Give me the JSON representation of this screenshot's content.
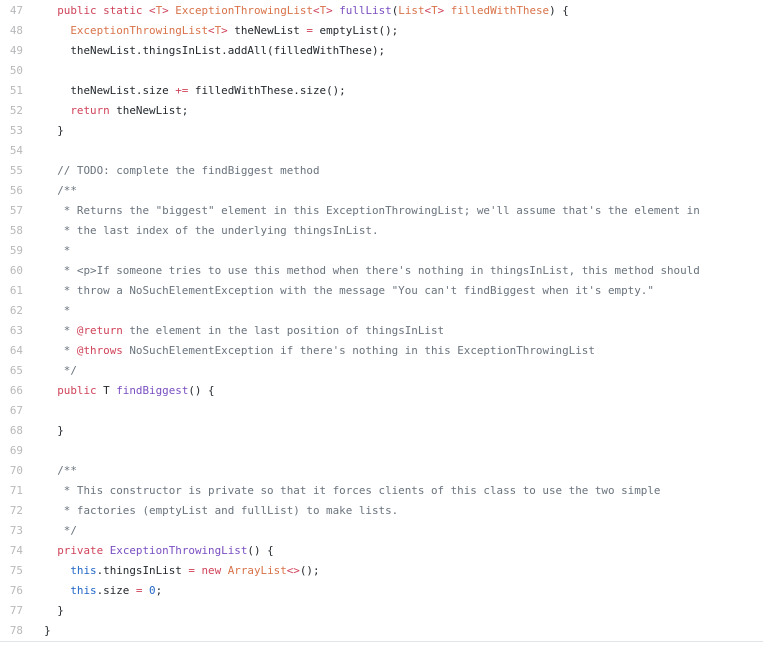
{
  "editor": {
    "language": "java",
    "lines": [
      {
        "num": "47",
        "tokens": [
          {
            "t": "    ",
            "c": "plain"
          },
          {
            "t": "public",
            "c": "kw"
          },
          {
            "t": " ",
            "c": "plain"
          },
          {
            "t": "static",
            "c": "kw"
          },
          {
            "t": " ",
            "c": "plain"
          },
          {
            "t": "<",
            "c": "kw"
          },
          {
            "t": "T",
            "c": "type"
          },
          {
            "t": ">",
            "c": "kw"
          },
          {
            "t": " ",
            "c": "plain"
          },
          {
            "t": "ExceptionThrowingList",
            "c": "type"
          },
          {
            "t": "<",
            "c": "kw"
          },
          {
            "t": "T",
            "c": "type"
          },
          {
            "t": ">",
            "c": "kw"
          },
          {
            "t": " ",
            "c": "plain"
          },
          {
            "t": "fullList",
            "c": "ent"
          },
          {
            "t": "(",
            "c": "plain"
          },
          {
            "t": "List",
            "c": "type"
          },
          {
            "t": "<",
            "c": "kw"
          },
          {
            "t": "T",
            "c": "type"
          },
          {
            "t": ">",
            "c": "kw"
          },
          {
            "t": " ",
            "c": "plain"
          },
          {
            "t": "filledWithThese",
            "c": "type"
          },
          {
            "t": ") {",
            "c": "plain"
          }
        ]
      },
      {
        "num": "48",
        "tokens": [
          {
            "t": "      ",
            "c": "plain"
          },
          {
            "t": "ExceptionThrowingList",
            "c": "type"
          },
          {
            "t": "<",
            "c": "kw"
          },
          {
            "t": "T",
            "c": "type"
          },
          {
            "t": ">",
            "c": "kw"
          },
          {
            "t": " theNewList ",
            "c": "plain"
          },
          {
            "t": "=",
            "c": "kw"
          },
          {
            "t": " emptyList();",
            "c": "plain"
          }
        ]
      },
      {
        "num": "49",
        "tokens": [
          {
            "t": "      theNewList.thingsInList.addAll(filledWithThese);",
            "c": "plain"
          }
        ]
      },
      {
        "num": "50",
        "tokens": []
      },
      {
        "num": "51",
        "tokens": [
          {
            "t": "      theNewList.size ",
            "c": "plain"
          },
          {
            "t": "+=",
            "c": "kw"
          },
          {
            "t": " filledWithThese.size();",
            "c": "plain"
          }
        ]
      },
      {
        "num": "52",
        "tokens": [
          {
            "t": "      ",
            "c": "plain"
          },
          {
            "t": "return",
            "c": "kw"
          },
          {
            "t": " theNewList;",
            "c": "plain"
          }
        ]
      },
      {
        "num": "53",
        "tokens": [
          {
            "t": "    }",
            "c": "plain"
          }
        ]
      },
      {
        "num": "54",
        "tokens": []
      },
      {
        "num": "55",
        "tokens": [
          {
            "t": "    ",
            "c": "plain"
          },
          {
            "t": "// TODO: complete the findBiggest method",
            "c": "cmt"
          }
        ]
      },
      {
        "num": "56",
        "tokens": [
          {
            "t": "    ",
            "c": "plain"
          },
          {
            "t": "/**",
            "c": "cmt"
          }
        ]
      },
      {
        "num": "57",
        "tokens": [
          {
            "t": "     * Returns the \"biggest\" element in this ExceptionThrowingList; we'll assume that's the element in",
            "c": "cmt"
          }
        ]
      },
      {
        "num": "58",
        "tokens": [
          {
            "t": "     * the last index of the underlying thingsInList.",
            "c": "cmt"
          }
        ]
      },
      {
        "num": "59",
        "tokens": [
          {
            "t": "     *",
            "c": "cmt"
          }
        ]
      },
      {
        "num": "60",
        "tokens": [
          {
            "t": "     * <p>If someone tries to use this method when there's nothing in thingsInList, this method should",
            "c": "cmt"
          }
        ]
      },
      {
        "num": "61",
        "tokens": [
          {
            "t": "     * throw a NoSuchElementException with the message \"You can't findBiggest when it's empty.\"",
            "c": "cmt"
          }
        ]
      },
      {
        "num": "62",
        "tokens": [
          {
            "t": "     *",
            "c": "cmt"
          }
        ]
      },
      {
        "num": "63",
        "tokens": [
          {
            "t": "     * ",
            "c": "cmt"
          },
          {
            "t": "@return",
            "c": "tag"
          },
          {
            "t": " the element in the last position of thingsInList",
            "c": "cmt"
          }
        ]
      },
      {
        "num": "64",
        "tokens": [
          {
            "t": "     * ",
            "c": "cmt"
          },
          {
            "t": "@throws",
            "c": "tag"
          },
          {
            "t": " NoSuchElementException if there's nothing in this ExceptionThrowingList",
            "c": "cmt"
          }
        ]
      },
      {
        "num": "65",
        "tokens": [
          {
            "t": "     */",
            "c": "cmt"
          }
        ]
      },
      {
        "num": "66",
        "tokens": [
          {
            "t": "    ",
            "c": "plain"
          },
          {
            "t": "public",
            "c": "kw"
          },
          {
            "t": " T ",
            "c": "plain"
          },
          {
            "t": "findBiggest",
            "c": "ent"
          },
          {
            "t": "() {",
            "c": "plain"
          }
        ]
      },
      {
        "num": "67",
        "tokens": []
      },
      {
        "num": "68",
        "tokens": [
          {
            "t": "    }",
            "c": "plain"
          }
        ]
      },
      {
        "num": "69",
        "tokens": []
      },
      {
        "num": "70",
        "tokens": [
          {
            "t": "    ",
            "c": "plain"
          },
          {
            "t": "/**",
            "c": "cmt"
          }
        ]
      },
      {
        "num": "71",
        "tokens": [
          {
            "t": "     * This constructor is private so that it forces clients of this class to use the two simple",
            "c": "cmt"
          }
        ]
      },
      {
        "num": "72",
        "tokens": [
          {
            "t": "     * factories (emptyList and fullList) to make lists.",
            "c": "cmt"
          }
        ]
      },
      {
        "num": "73",
        "tokens": [
          {
            "t": "     */",
            "c": "cmt"
          }
        ]
      },
      {
        "num": "74",
        "tokens": [
          {
            "t": "    ",
            "c": "plain"
          },
          {
            "t": "private",
            "c": "kw"
          },
          {
            "t": " ",
            "c": "plain"
          },
          {
            "t": "ExceptionThrowingList",
            "c": "ent"
          },
          {
            "t": "() {",
            "c": "plain"
          }
        ]
      },
      {
        "num": "75",
        "tokens": [
          {
            "t": "      ",
            "c": "plain"
          },
          {
            "t": "this",
            "c": "const"
          },
          {
            "t": ".thingsInList ",
            "c": "plain"
          },
          {
            "t": "=",
            "c": "kw"
          },
          {
            "t": " ",
            "c": "plain"
          },
          {
            "t": "new",
            "c": "kw"
          },
          {
            "t": " ",
            "c": "plain"
          },
          {
            "t": "ArrayList",
            "c": "type"
          },
          {
            "t": "<>",
            "c": "kw"
          },
          {
            "t": "();",
            "c": "plain"
          }
        ]
      },
      {
        "num": "76",
        "tokens": [
          {
            "t": "      ",
            "c": "plain"
          },
          {
            "t": "this",
            "c": "const"
          },
          {
            "t": ".size ",
            "c": "plain"
          },
          {
            "t": "=",
            "c": "kw"
          },
          {
            "t": " ",
            "c": "plain"
          },
          {
            "t": "0",
            "c": "const"
          },
          {
            "t": ";",
            "c": "plain"
          }
        ]
      },
      {
        "num": "77",
        "tokens": [
          {
            "t": "    }",
            "c": "plain"
          }
        ]
      },
      {
        "num": "78",
        "tokens": [
          {
            "t": "  }",
            "c": "plain"
          }
        ]
      }
    ]
  },
  "syntax_colors": {
    "keyword": "#d0435a",
    "type": "#d9734a",
    "entity": "#7a4fc0",
    "comment": "#6a737d",
    "constant": "#1f66c6",
    "plain": "#24292e",
    "line_number": "#b7b8ba"
  }
}
